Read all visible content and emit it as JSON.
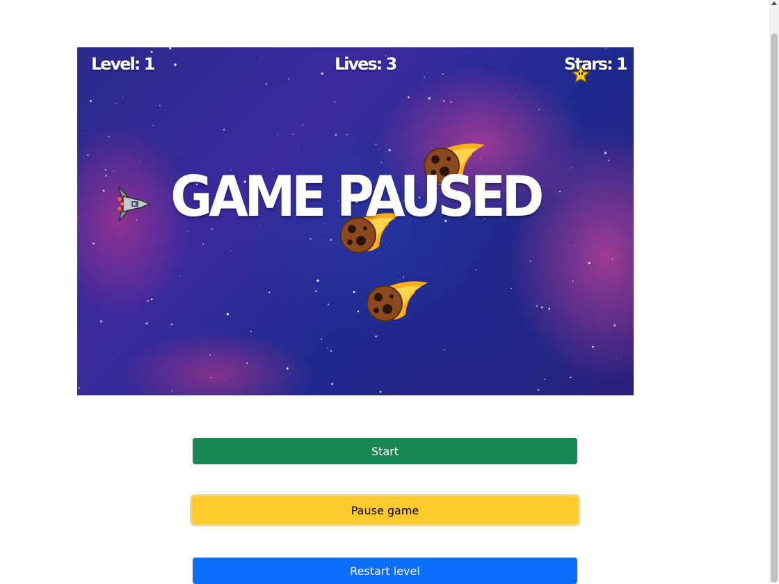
{
  "hud": {
    "level": "Level: 1",
    "lives": "Lives: 3",
    "stars": "Stars: 1"
  },
  "overlay": {
    "paused_text": "GAME PAUSED"
  },
  "sprites": {
    "player": "spaceship-icon",
    "collectible": "star-icon",
    "enemies": [
      "meteor-icon",
      "meteor-icon",
      "meteor-icon"
    ]
  },
  "controls": {
    "start_label": "Start",
    "pause_label": "Pause game",
    "restart_label": "Restart level"
  },
  "colors": {
    "start": "#198754",
    "pause": "#ffca2c",
    "restart": "#0d6efd"
  }
}
